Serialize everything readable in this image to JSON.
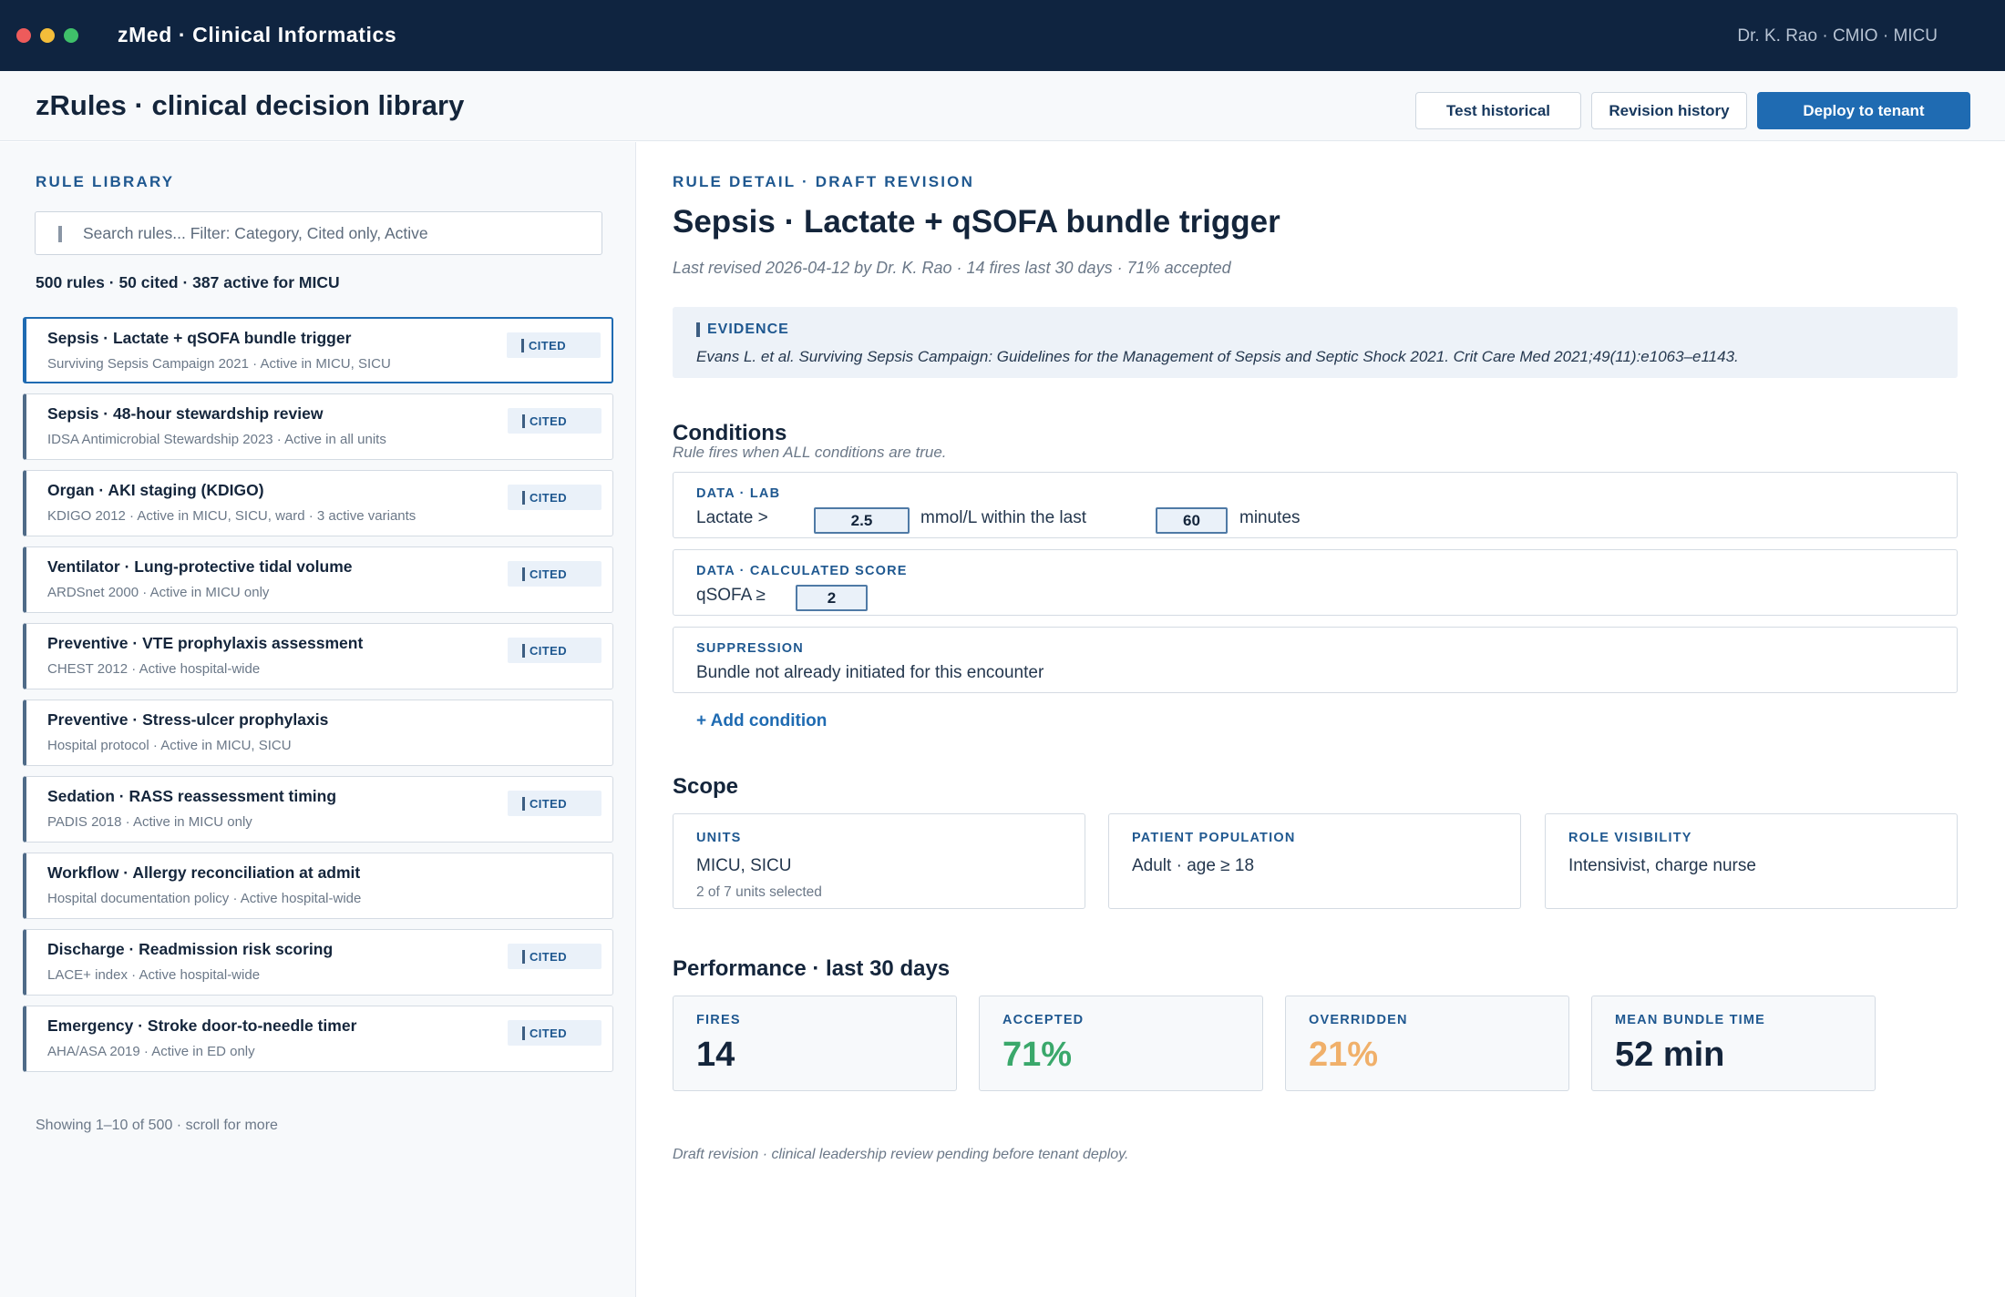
{
  "window": {
    "app_title": "zMed · Clinical Informatics",
    "user": "Dr. K. Rao · CMIO · MICU"
  },
  "header": {
    "title": "zRules · clinical decision library",
    "buttons": {
      "test_historical": "Test historical",
      "revision_history": "Revision history",
      "deploy": "Deploy to tenant"
    }
  },
  "library": {
    "label": "RULE LIBRARY",
    "search_placeholder": "Search rules... Filter: Category, Cited only, Active",
    "count": "500 rules · 50 cited · 387 active for MICU",
    "cited_label": "CITED",
    "rules": [
      {
        "title": "Sepsis · Lactate + qSOFA bundle trigger",
        "sub": "Surviving Sepsis Campaign 2021 · Active in MICU, SICU",
        "cited": true,
        "selected": true
      },
      {
        "title": "Sepsis · 48-hour stewardship review",
        "sub": "IDSA Antimicrobial Stewardship 2023 · Active in all units",
        "cited": true
      },
      {
        "title": "Organ · AKI staging (KDIGO)",
        "sub": "KDIGO 2012 · Active in MICU, SICU, ward · 3 active variants",
        "cited": true
      },
      {
        "title": "Ventilator · Lung-protective tidal volume",
        "sub": "ARDSnet 2000 · Active in MICU only",
        "cited": true
      },
      {
        "title": "Preventive · VTE prophylaxis assessment",
        "sub": "CHEST 2012 · Active hospital-wide",
        "cited": true
      },
      {
        "title": "Preventive · Stress-ulcer prophylaxis",
        "sub": "Hospital protocol · Active in MICU, SICU",
        "cited": false
      },
      {
        "title": "Sedation · RASS reassessment timing",
        "sub": "PADIS 2018 · Active in MICU only",
        "cited": true
      },
      {
        "title": "Workflow · Allergy reconciliation at admit",
        "sub": "Hospital documentation policy · Active hospital-wide",
        "cited": false
      },
      {
        "title": "Discharge · Readmission risk scoring",
        "sub": "LACE+ index · Active hospital-wide",
        "cited": true
      },
      {
        "title": "Emergency · Stroke door-to-needle timer",
        "sub": "AHA/ASA 2019 · Active in ED only",
        "cited": true
      }
    ],
    "footer": "Showing 1–10 of 500 · scroll for more"
  },
  "detail": {
    "label": "RULE DETAIL · DRAFT REVISION",
    "name": "Sepsis · Lactate + qSOFA bundle trigger",
    "revised": "Last revised 2026-04-12 by Dr. K. Rao · 14 fires last 30 days · 71% accepted",
    "evidence": {
      "label": "EVIDENCE",
      "text": "Evans L. et al. Surviving Sepsis Campaign: Guidelines for the Management of Sepsis and Septic Shock 2021. Crit Care Med 2021;49(11):e1063–e1143."
    },
    "conditions": {
      "heading": "Conditions",
      "subtitle": "Rule fires when ALL conditions are true.",
      "lab": {
        "kind": "DATA · LAB",
        "prefix": "Lactate >",
        "threshold": "2.5",
        "middle": "mmol/L within the last",
        "window": "60",
        "suffix": "minutes"
      },
      "score": {
        "kind": "DATA · CALCULATED SCORE",
        "prefix": "qSOFA ≥",
        "threshold": "2"
      },
      "suppression": {
        "kind": "SUPPRESSION",
        "text": "Bundle not already initiated for this encounter"
      },
      "add_label": "+ Add condition"
    },
    "scope": {
      "heading": "Scope",
      "units": {
        "label": "UNITS",
        "value": "MICU, SICU",
        "note": "2 of 7 units selected"
      },
      "population": {
        "label": "PATIENT POPULATION",
        "value": "Adult · age ≥ 18"
      },
      "roles": {
        "label": "ROLE VISIBILITY",
        "value": "Intensivist, charge nurse"
      }
    },
    "performance": {
      "heading": "Performance · last 30 days",
      "fires": {
        "label": "FIRES",
        "value": "14",
        "color": "#14253b"
      },
      "accepted": {
        "label": "ACCEPTED",
        "value": "71%",
        "color": "#3aa86b"
      },
      "overridden": {
        "label": "OVERRIDDEN",
        "value": "21%",
        "color": "#f0b06a"
      },
      "bundle_time": {
        "label": "MEAN BUNDLE TIME",
        "value": "52 min",
        "color": "#14253b"
      }
    },
    "footer_note": "Draft revision · clinical leadership review pending before tenant deploy."
  }
}
